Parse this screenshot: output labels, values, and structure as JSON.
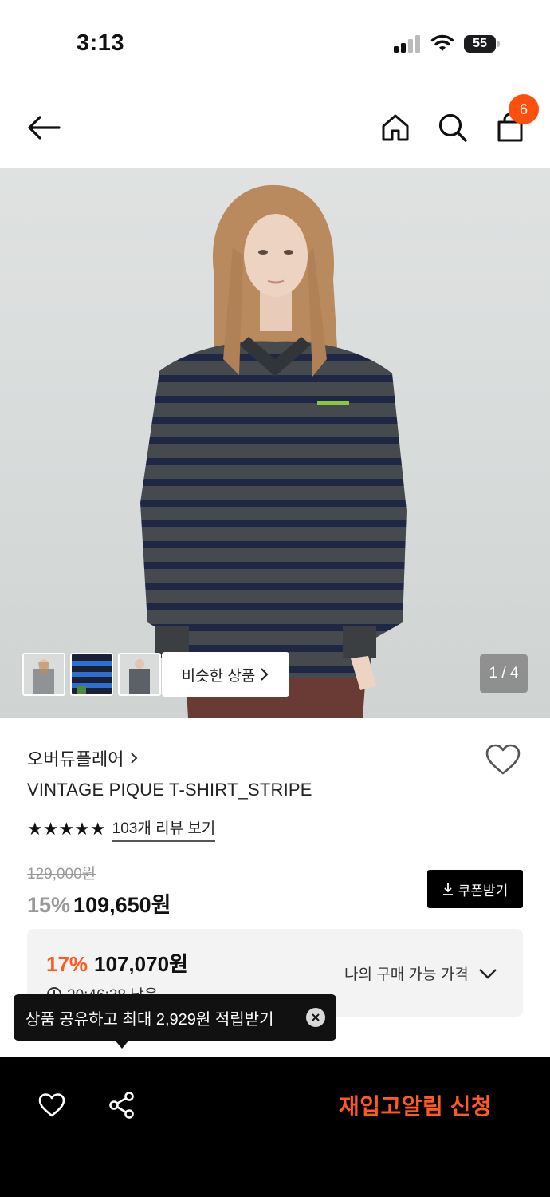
{
  "status_bar": {
    "time": "3:13",
    "battery": "55"
  },
  "nav": {
    "cart_count": "6",
    "icons": [
      "back-arrow-icon",
      "home-icon",
      "search-icon",
      "shopping-bag-icon"
    ]
  },
  "gallery": {
    "similar_label": "비슷한 상품",
    "page_indicator": "1 / 4",
    "thumbnail_count": 3
  },
  "product": {
    "brand": "오버듀플레어",
    "name": "VINTAGE PIQUE T-SHIRT_STRIPE",
    "stars": "★★★★★",
    "review_link": "103개 리뷰 보기",
    "original_price": "129,000원",
    "discount": "15%",
    "sale_price": "109,650원",
    "coupon_label": "쿠폰받기"
  },
  "best_price": {
    "discount": "17%",
    "price": "107,070원",
    "timer": "20:46:38 남음",
    "my_price_label": "나의 구매 가능 가격"
  },
  "tooltip": {
    "text": "상품 공유하고 최대 2,929원 적립받기"
  },
  "bottom_bar": {
    "restock_label": "재입고알림 신청"
  },
  "colors": {
    "accent": "#ff5a1f",
    "badge": "#ff4f0f",
    "stripe_dark": "#1f2a47",
    "stripe_grey": "#3f4346"
  }
}
